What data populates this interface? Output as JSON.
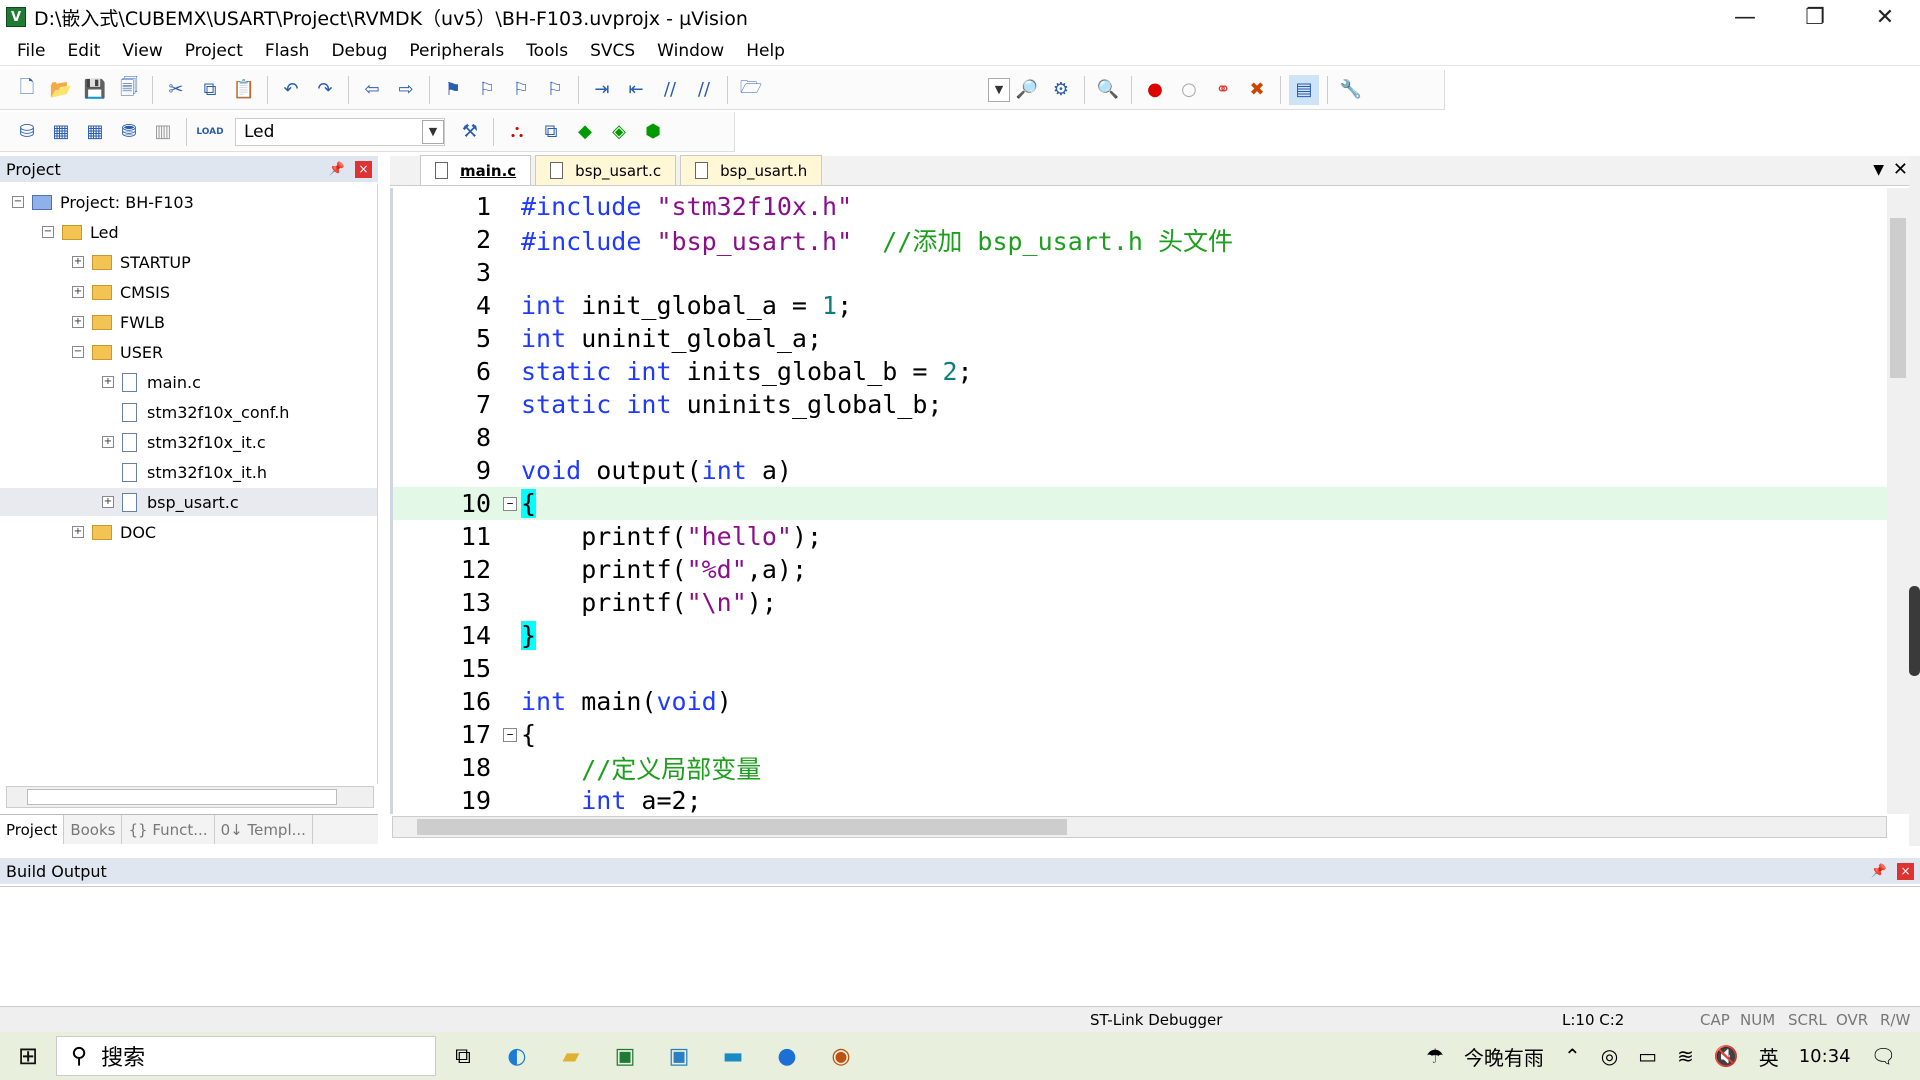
{
  "window": {
    "title": "D:\\嵌入式\\CUBEMX\\USART\\Project\\RVMDK（uv5）\\BH-F103.uvprojx - µVision",
    "app_icon_letter": "V",
    "minimize": "—",
    "restore": "❐",
    "close": "✕"
  },
  "menu": [
    "File",
    "Edit",
    "View",
    "Project",
    "Flash",
    "Debug",
    "Peripherals",
    "Tools",
    "SVCS",
    "Window",
    "Help"
  ],
  "toolbar": {
    "target": "Led",
    "load_label": "LOAD"
  },
  "project_panel": {
    "title": "Project",
    "pin": "📌",
    "close": "×",
    "tree": [
      {
        "label": "Project: BH-F103",
        "toggle": "⊟"
      },
      {
        "label": "Led",
        "toggle": "⊟"
      },
      {
        "label": "STARTUP",
        "toggle": "⊞"
      },
      {
        "label": "CMSIS",
        "toggle": "⊞"
      },
      {
        "label": "FWLB",
        "toggle": "⊞"
      },
      {
        "label": "USER",
        "toggle": "⊟"
      },
      {
        "label": "main.c",
        "toggle": "⊞"
      },
      {
        "label": "stm32f10x_conf.h",
        "toggle": ""
      },
      {
        "label": "stm32f10x_it.c",
        "toggle": "⊞"
      },
      {
        "label": "stm32f10x_it.h",
        "toggle": ""
      },
      {
        "label": "bsp_usart.c",
        "toggle": "⊞"
      },
      {
        "label": "DOC",
        "toggle": "⊞"
      }
    ],
    "tabs": [
      "Project",
      "Books",
      "{} Funct...",
      "0↓ Templ..."
    ]
  },
  "editor": {
    "tabs": [
      "main.c",
      "bsp_usart.c",
      "bsp_usart.h"
    ],
    "active_tab": "main.c",
    "lines": [
      {
        "n": "1",
        "seg": [
          [
            "#include ",
            "kw"
          ],
          [
            "\"stm32f10x.h\"",
            "str"
          ]
        ]
      },
      {
        "n": "2",
        "seg": [
          [
            "#include ",
            "kw"
          ],
          [
            "\"bsp_usart.h\"",
            "str"
          ],
          [
            "  //添加 bsp_usart.h 头文件",
            "cmt"
          ]
        ]
      },
      {
        "n": "3",
        "seg": []
      },
      {
        "n": "4",
        "seg": [
          [
            "int",
            "kw"
          ],
          [
            " init_global_a = ",
            ""
          ],
          [
            "1",
            "num"
          ],
          [
            ";",
            ""
          ]
        ]
      },
      {
        "n": "5",
        "seg": [
          [
            "int",
            "kw"
          ],
          [
            " uninit_global_a;",
            ""
          ]
        ]
      },
      {
        "n": "6",
        "seg": [
          [
            "static",
            "kw"
          ],
          [
            " ",
            ""
          ],
          [
            "int",
            "kw"
          ],
          [
            " inits_global_b = ",
            ""
          ],
          [
            "2",
            "num"
          ],
          [
            ";",
            ""
          ]
        ]
      },
      {
        "n": "7",
        "seg": [
          [
            "static",
            "kw"
          ],
          [
            " ",
            ""
          ],
          [
            "int",
            "kw"
          ],
          [
            " uninits_global_b;",
            ""
          ]
        ]
      },
      {
        "n": "8",
        "seg": []
      },
      {
        "n": "9",
        "seg": [
          [
            "void",
            "kw"
          ],
          [
            " output(",
            ""
          ],
          [
            "int",
            "kw"
          ],
          [
            " a)",
            ""
          ]
        ]
      },
      {
        "n": "10",
        "seg": [
          [
            "{",
            "brc"
          ]
        ],
        "fold": "⊟",
        "hl": true
      },
      {
        "n": "11",
        "seg": [
          [
            "    printf(",
            ""
          ],
          [
            "\"hello\"",
            "str"
          ],
          [
            ");",
            ""
          ]
        ]
      },
      {
        "n": "12",
        "seg": [
          [
            "    printf(",
            ""
          ],
          [
            "\"%d\"",
            "str"
          ],
          [
            ",a);",
            ""
          ]
        ]
      },
      {
        "n": "13",
        "seg": [
          [
            "    printf(",
            ""
          ],
          [
            "\"\\n\"",
            "str"
          ],
          [
            ");",
            ""
          ]
        ]
      },
      {
        "n": "14",
        "seg": [
          [
            "}",
            "brc"
          ]
        ]
      },
      {
        "n": "15",
        "seg": []
      },
      {
        "n": "16",
        "seg": [
          [
            "int",
            "kw"
          ],
          [
            " main(",
            ""
          ],
          [
            "void",
            "kw"
          ],
          [
            ")",
            ""
          ]
        ]
      },
      {
        "n": "17",
        "seg": [
          [
            "{",
            ""
          ]
        ],
        "fold": "⊟"
      },
      {
        "n": "18",
        "seg": [
          [
            "    //定义局部变量",
            "cmt"
          ]
        ]
      },
      {
        "n": "19",
        "seg": [
          [
            "    ",
            ""
          ],
          [
            "int",
            "kw"
          ],
          [
            " a=2;",
            ""
          ]
        ]
      }
    ]
  },
  "build_output": {
    "title": "Build Output"
  },
  "status": {
    "debugger": "ST-Link Debugger",
    "position": "L:10 C:2",
    "caps": "CAP",
    "num": "NUM",
    "scrl": "SCRL",
    "ovr": "OVR",
    "rw": "R/W"
  },
  "taskbar": {
    "search_placeholder": "搜索",
    "weather": "今晚有雨",
    "ime": "英",
    "time": "10:34"
  }
}
